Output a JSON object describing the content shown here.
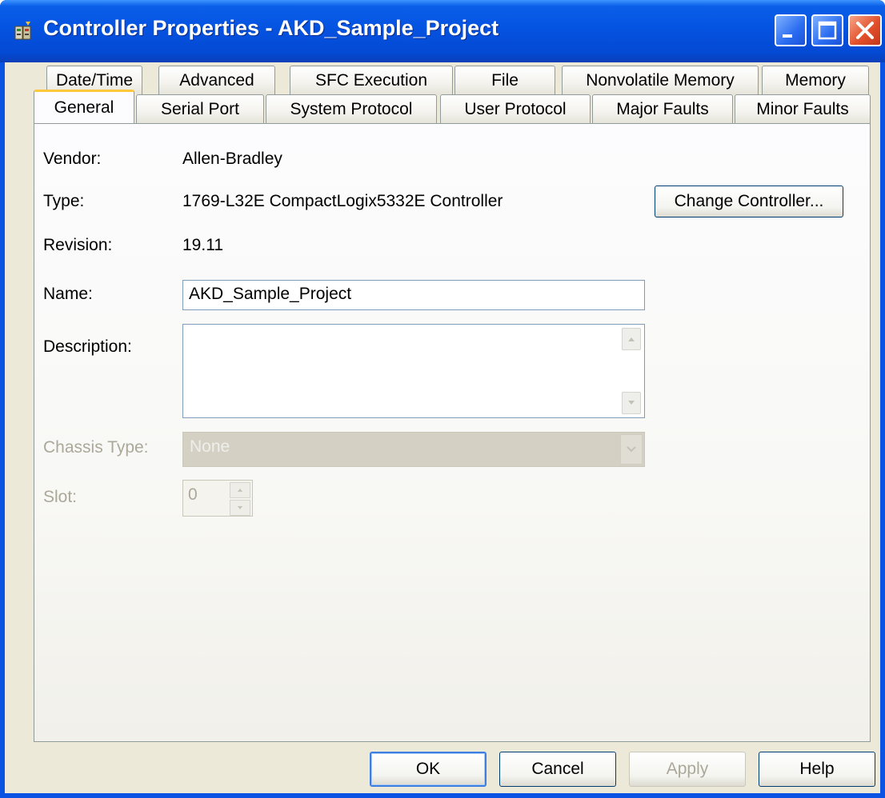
{
  "window": {
    "title": "Controller Properties - AKD_Sample_Project"
  },
  "tabs": {
    "row1": [
      "Date/Time",
      "Advanced",
      "SFC Execution",
      "File",
      "Nonvolatile Memory",
      "Memory"
    ],
    "row2": [
      "General",
      "Serial Port",
      "System Protocol",
      "User Protocol",
      "Major Faults",
      "Minor Faults"
    ],
    "active": "General"
  },
  "general": {
    "vendor_label": "Vendor:",
    "vendor_value": "Allen-Bradley",
    "type_label": "Type:",
    "type_value": "1769-L32E CompactLogix5332E Controller",
    "change_controller_label": "Change Controller...",
    "revision_label": "Revision:",
    "revision_value": "19.11",
    "name_label": "Name:",
    "name_value": "AKD_Sample_Project",
    "description_label": "Description:",
    "description_value": "",
    "chassis_type_label": "Chassis Type:",
    "chassis_type_value": "None",
    "slot_label": "Slot:",
    "slot_value": "0"
  },
  "buttons": {
    "ok": "OK",
    "cancel": "Cancel",
    "apply": "Apply",
    "help": "Help"
  },
  "colors": {
    "titlebar": "#0553e1",
    "dialog_face": "#ece9d8",
    "active_tab_highlight": "#ffc83c",
    "close_button": "#e2512c"
  }
}
